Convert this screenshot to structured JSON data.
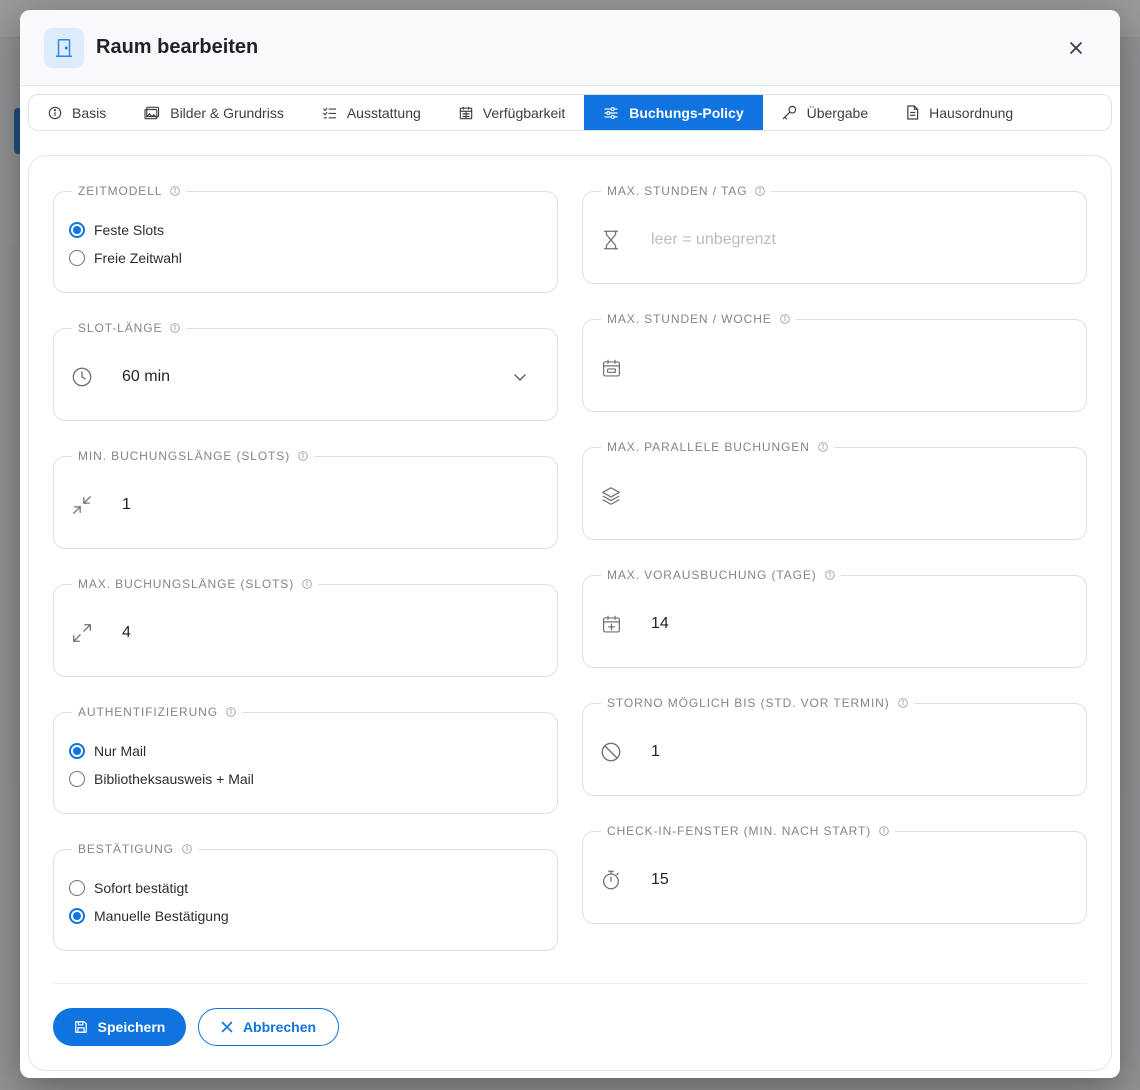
{
  "modal": {
    "title": "Raum bearbeiten",
    "close_label": "close"
  },
  "tabs": [
    {
      "label": "Basis",
      "icon": "info-circle-icon",
      "active": false
    },
    {
      "label": "Bilder & Grundriss",
      "icon": "image-icon",
      "active": false
    },
    {
      "label": "Ausstattung",
      "icon": "checklist-icon",
      "active": false
    },
    {
      "label": "Verfügbarkeit",
      "icon": "calendar-icon",
      "active": false
    },
    {
      "label": "Buchungs-Policy",
      "icon": "sliders-icon",
      "active": true
    },
    {
      "label": "Übergabe",
      "icon": "key-icon",
      "active": false
    },
    {
      "label": "Hausordnung",
      "icon": "document-icon",
      "active": false
    }
  ],
  "left": {
    "zeitmodell": {
      "label": "ZEITMODELL",
      "options": [
        "Feste Slots",
        "Freie Zeitwahl"
      ],
      "selected": 0
    },
    "slot_laenge": {
      "label": "SLOT-LÄNGE",
      "value": "60 min",
      "icon": "clock-icon"
    },
    "min_buchung": {
      "label": "MIN. BUCHUNGSLÄNGE (SLOTS)",
      "value": "1",
      "icon": "arrows-collapse-icon"
    },
    "max_buchung": {
      "label": "MAX. BUCHUNGSLÄNGE (SLOTS)",
      "value": "4",
      "icon": "arrows-expand-icon"
    },
    "auth": {
      "label": "AUTHENTIFIZIERUNG",
      "options": [
        "Nur Mail",
        "Bibliotheksausweis + Mail"
      ],
      "selected": 0
    },
    "bestaetigung": {
      "label": "BESTÄTIGUNG",
      "options": [
        "Sofort bestätigt",
        "Manuelle Bestätigung"
      ],
      "selected": 1
    }
  },
  "right": {
    "max_tag": {
      "label": "MAX. STUNDEN / TAG",
      "value": "",
      "placeholder": "leer = unbegrenzt",
      "icon": "hourglass-icon"
    },
    "max_woche": {
      "label": "MAX. STUNDEN / WOCHE",
      "value": "",
      "icon": "calendar-week-icon"
    },
    "max_parallel": {
      "label": "MAX. PARALLELE BUCHUNGEN",
      "value": "",
      "icon": "layers-icon"
    },
    "max_voraus": {
      "label": "MAX. VORAUSBUCHUNG (TAGE)",
      "value": "14",
      "icon": "calendar-plus-icon"
    },
    "storno": {
      "label": "STORNO MÖGLICH BIS (STD. VOR TERMIN)",
      "value": "1",
      "icon": "ban-icon"
    },
    "checkin": {
      "label": "CHECK-IN-FENSTER (MIN. NACH START)",
      "value": "15",
      "icon": "stopwatch-icon"
    }
  },
  "actions": {
    "save": "Speichern",
    "cancel": "Abbrechen"
  },
  "colors": {
    "primary": "#0f74e0",
    "border": "#dcdfe3",
    "label": "#80868d"
  }
}
